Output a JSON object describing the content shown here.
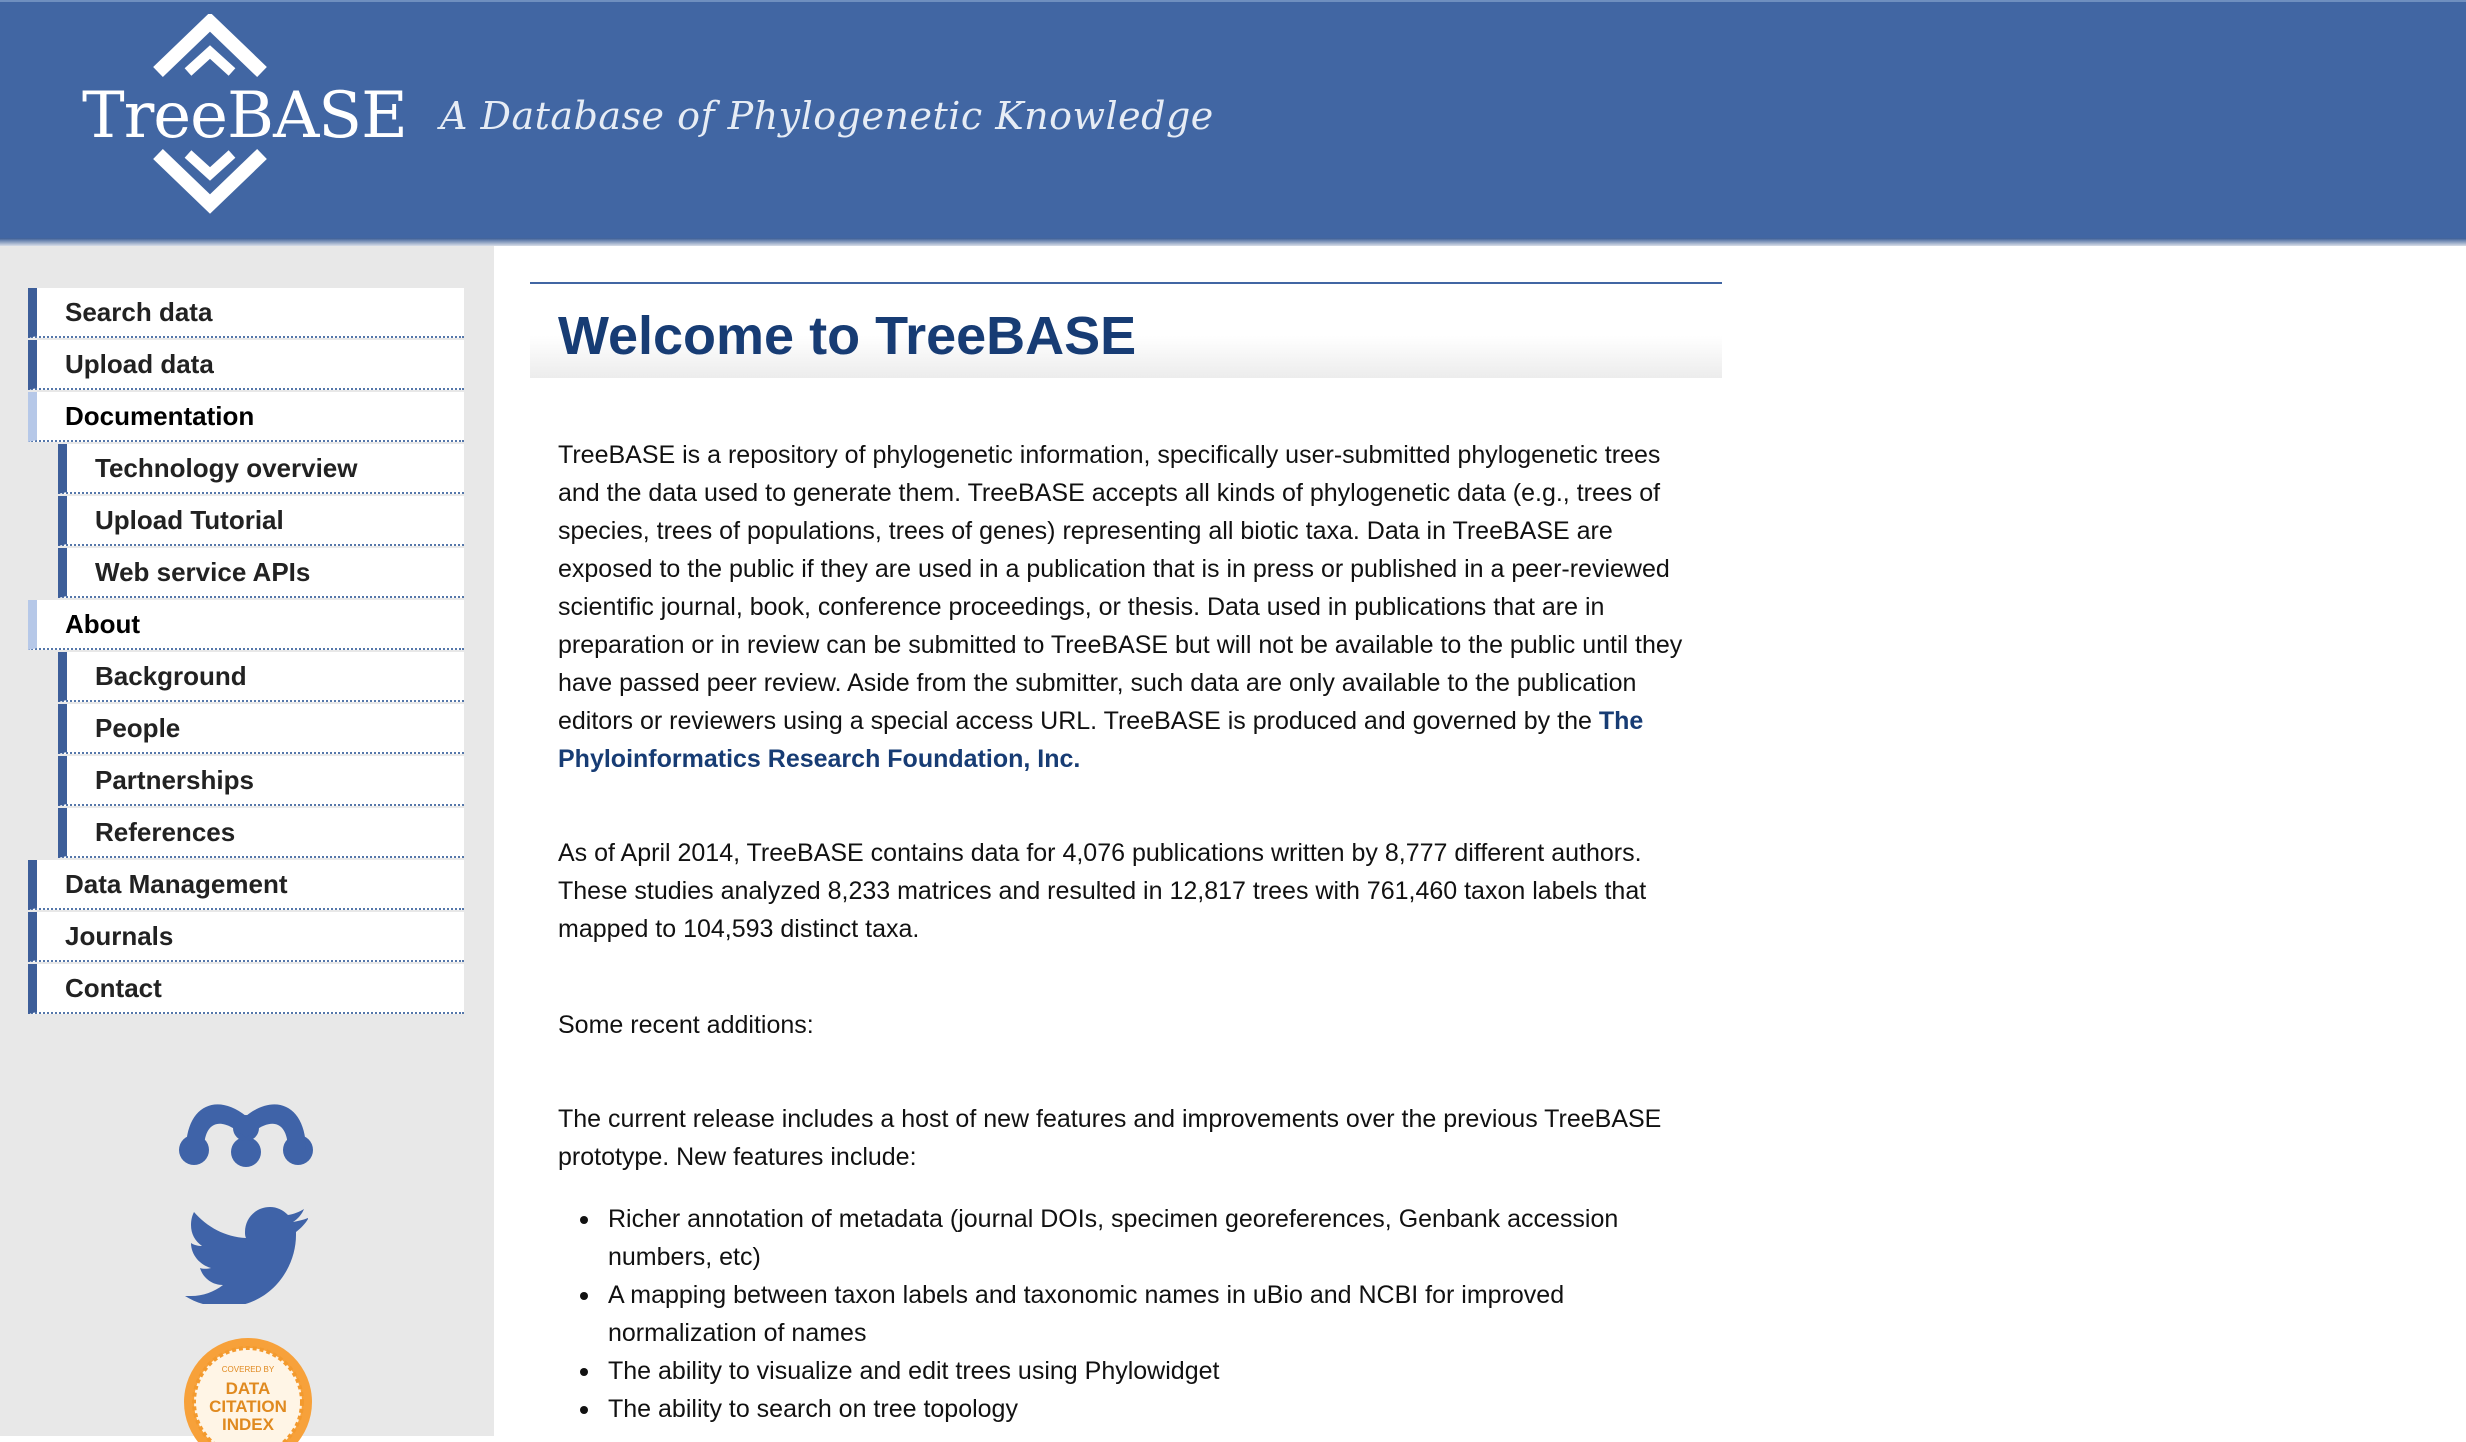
{
  "header": {
    "logo_text": "TreeBASE",
    "tagline": "A Database of Phylogenetic Knowledge",
    "bg_color": "#4166a3"
  },
  "sidebar": {
    "nav": [
      {
        "label": "Search data",
        "level": 1
      },
      {
        "label": "Upload data",
        "level": 1
      },
      {
        "label": "Documentation",
        "level": 1,
        "open": true
      },
      {
        "label": "Technology overview",
        "level": 2
      },
      {
        "label": "Upload Tutorial",
        "level": 2
      },
      {
        "label": "Web service APIs",
        "level": 2
      },
      {
        "label": "About",
        "level": 1,
        "open": true
      },
      {
        "label": "Background",
        "level": 2
      },
      {
        "label": "People",
        "level": 2
      },
      {
        "label": "Partnerships",
        "level": 2
      },
      {
        "label": "References",
        "level": 2
      },
      {
        "label": "Data Management",
        "level": 1
      },
      {
        "label": "Journals",
        "level": 1
      },
      {
        "label": "Contact",
        "level": 1
      }
    ],
    "social_icons": [
      "mendeley-icon",
      "twitter-icon"
    ],
    "badge_text": [
      "COVERED BY",
      "DATA",
      "CITATION",
      "INDEX"
    ]
  },
  "main": {
    "title": "Welcome to TreeBASE",
    "intro": "TreeBASE is a repository of phylogenetic information, specifically user-submitted phylogenetic trees and the data used to generate them. TreeBASE accepts all kinds of phylogenetic data (e.g., trees of species, trees of populations, trees of genes) representing all biotic taxa. Data in TreeBASE are exposed to the public if they are used in a publication that is in press or published in a peer-reviewed scientific journal, book, conference proceedings, or thesis. Data used in publications that are in preparation or in review can be submitted to TreeBASE but will not be available to the public until they have passed peer review. Aside from the submitter, such data are only available to the publication editors or reviewers using a special access URL. TreeBASE is produced and governed by the ",
    "foundation_link": "The Phyloinformatics Research Foundation, Inc.",
    "stats": "As of April 2014, TreeBASE contains data for 4,076 publications written by 8,777 different authors. These studies analyzed 8,233 matrices and resulted in 12,817 trees with 761,460 taxon labels that mapped to 104,593 distinct taxa.",
    "recent": "Some recent additions:",
    "release": "The current release includes a host of new features and improvements over the previous TreeBASE prototype. New features include:",
    "features": [
      "Richer annotation of metadata (journal DOIs, specimen georeferences, Genbank accession numbers, etc)",
      "A mapping between taxon labels and taxonomic names in uBio and NCBI for improved normalization of names",
      "The ability to visualize and edit trees using Phylowidget",
      "The ability to search on tree topology"
    ]
  }
}
